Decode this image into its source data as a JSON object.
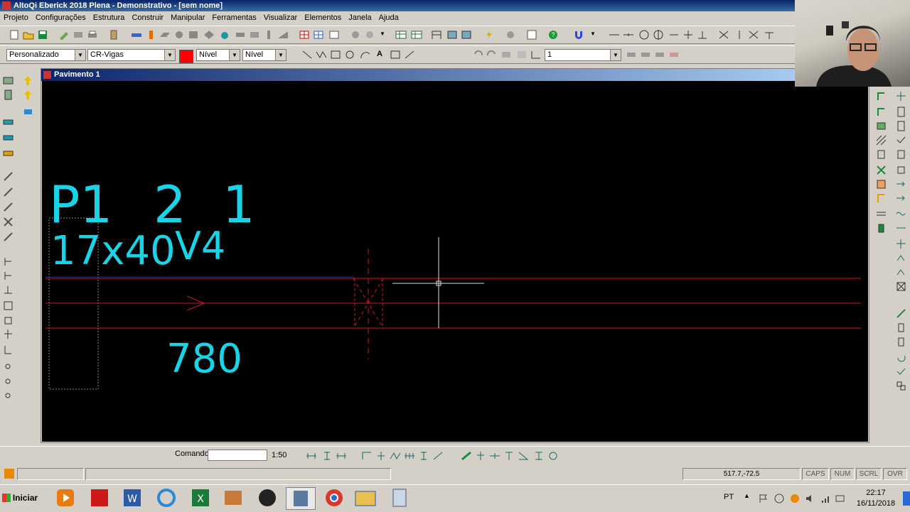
{
  "window": {
    "title": "AltoQi Eberick 2018 Plena - Demonstrativo - [sem nome]"
  },
  "menu": [
    "Projeto",
    "Configurações",
    "Estrutura",
    "Construir",
    "Manipular",
    "Ferramentas",
    "Visualizar",
    "Elementos",
    "Janela",
    "Ajuda"
  ],
  "toolbar2": {
    "style_combo": "Personalizado",
    "layer_combo": "CR-Vigas",
    "color_swatch": "#ff0000",
    "level_combo_1": "Nível",
    "level_combo_2": "Nível",
    "view_combo": "1"
  },
  "document": {
    "title": "Pavimento 1",
    "drawing": {
      "label_top": [
        "P1",
        "2",
        "1"
      ],
      "label_section": "17x40",
      "label_beam": "V4",
      "label_span": "780"
    }
  },
  "command": {
    "label": "Comando",
    "input_value": "",
    "scale": "1:50"
  },
  "status": {
    "coords": "517.7,-72.5",
    "caps": "CAPS",
    "num": "NUM",
    "scrl": "SCRL",
    "ovr": "OVR"
  },
  "taskbar": {
    "start_label": "Iniciar",
    "lang": "PT",
    "time": "22:17",
    "date": "16/11/2018"
  },
  "colors": {
    "cad_text": "#19d4e6",
    "cad_red": "#d01818",
    "cad_blue": "#1a2ea0"
  }
}
